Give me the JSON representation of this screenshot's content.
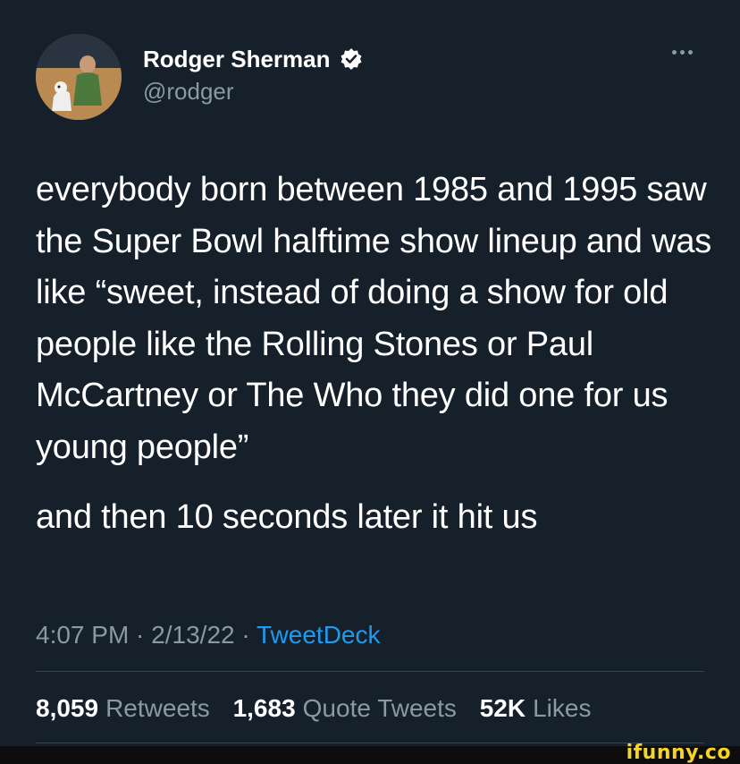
{
  "author": {
    "display_name": "Rodger Sherman",
    "handle": "@rodger"
  },
  "tweet": {
    "paragraphs": [
      "everybody born between 1985 and 1995 saw the Super Bowl halftime show lineup and was like “sweet, instead of doing a show for old people like the Rolling Stones or Paul McCartney or The Who they did one for us young people”",
      "and then 10 seconds later it hit us"
    ],
    "time": "4:07 PM",
    "date": "2/13/22",
    "separator": " · ",
    "source": "TweetDeck"
  },
  "stats": {
    "retweets_count": "8,059",
    "retweets_label": "Retweets",
    "quotes_count": "1,683",
    "quotes_label": "Quote Tweets",
    "likes_count": "52K",
    "likes_label": "Likes"
  },
  "watermark": "ifunny.co",
  "icons": {
    "verified": "verified-badge-icon",
    "more": "more-options-icon"
  },
  "colors": {
    "background": "#15202b",
    "text": "#ffffff",
    "muted": "#8b98a5",
    "link": "#1d9bf0",
    "divider": "#38444d",
    "watermark": "#f5d425"
  }
}
